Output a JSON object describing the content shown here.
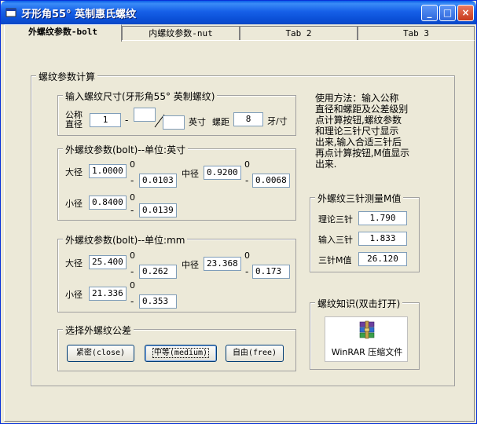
{
  "window": {
    "title": "牙形角55° 英制惠氏螺纹",
    "controls": {
      "minimize": "_",
      "maximize": "□",
      "close": "×"
    }
  },
  "tabs": [
    {
      "label": "外螺纹参数-bolt",
      "active": true
    },
    {
      "label": "内螺纹参数-nut",
      "active": false
    },
    {
      "label": "Tab 2",
      "active": false
    },
    {
      "label": "Tab 3",
      "active": false
    }
  ],
  "calc": {
    "title": "螺纹参数计算",
    "input": {
      "title": "输入螺纹尺寸(牙形角55° 英制螺纹)",
      "nominal_label_1": "公称",
      "nominal_label_2": "直径",
      "nominal_value": "1",
      "fraction_sep": "-",
      "numerator": "",
      "denominator": "",
      "unit_inch": "英寸",
      "pitch_label": "螺距",
      "pitch_value": "8",
      "pitch_unit": "牙/寸"
    },
    "inch": {
      "title": "外螺纹参数(bolt)--单位:英寸",
      "major_label": "大径",
      "major_value": "1.0000",
      "major_upper": "0",
      "major_lower": "0.0103",
      "pitch_dia_label": "中径",
      "pitch_dia_value": "0.9200",
      "pitch_dia_upper": "0",
      "pitch_dia_lower": "0.0068",
      "minor_label": "小径",
      "minor_value": "0.8400",
      "minor_upper": "0",
      "minor_lower": "0.0139"
    },
    "mm": {
      "title": "外螺纹参数(bolt)--单位:mm",
      "major_label": "大径",
      "major_value": "25.400",
      "major_upper": "0",
      "major_lower": "0.262",
      "pitch_dia_label": "中径",
      "pitch_dia_value": "23.368",
      "pitch_dia_upper": "0",
      "pitch_dia_lower": "0.173",
      "minor_label": "小径",
      "minor_value": "21.336",
      "minor_upper": "0",
      "minor_lower": "0.353"
    },
    "tolerance": {
      "title": "选择外螺纹公差",
      "close_label": "紧密(close)",
      "medium_label": "中等(medium)",
      "free_label": "自由(free)"
    }
  },
  "help": {
    "line1": "使用方法：输入公称",
    "line2": "直径和螺距及公差级别",
    "line3": "点计算按钮,螺纹参数",
    "line4": "和理论三针尺寸显示",
    "line5": "出来,输入合适三针后",
    "line6": "再点计算按钮,M值显示",
    "line7": "出来."
  },
  "three_wire": {
    "title": "外螺纹三针测量M值",
    "theory_label": "理论三针",
    "theory_value": "1.790",
    "input_label": "输入三针",
    "input_value": "1.833",
    "m_label": "三针M值",
    "m_value": "26.120"
  },
  "knowledge": {
    "title": "螺纹知识(双击打开)",
    "file_label": "WinRAR 压缩文件",
    "file_icon": "winrar-archive-icon"
  }
}
